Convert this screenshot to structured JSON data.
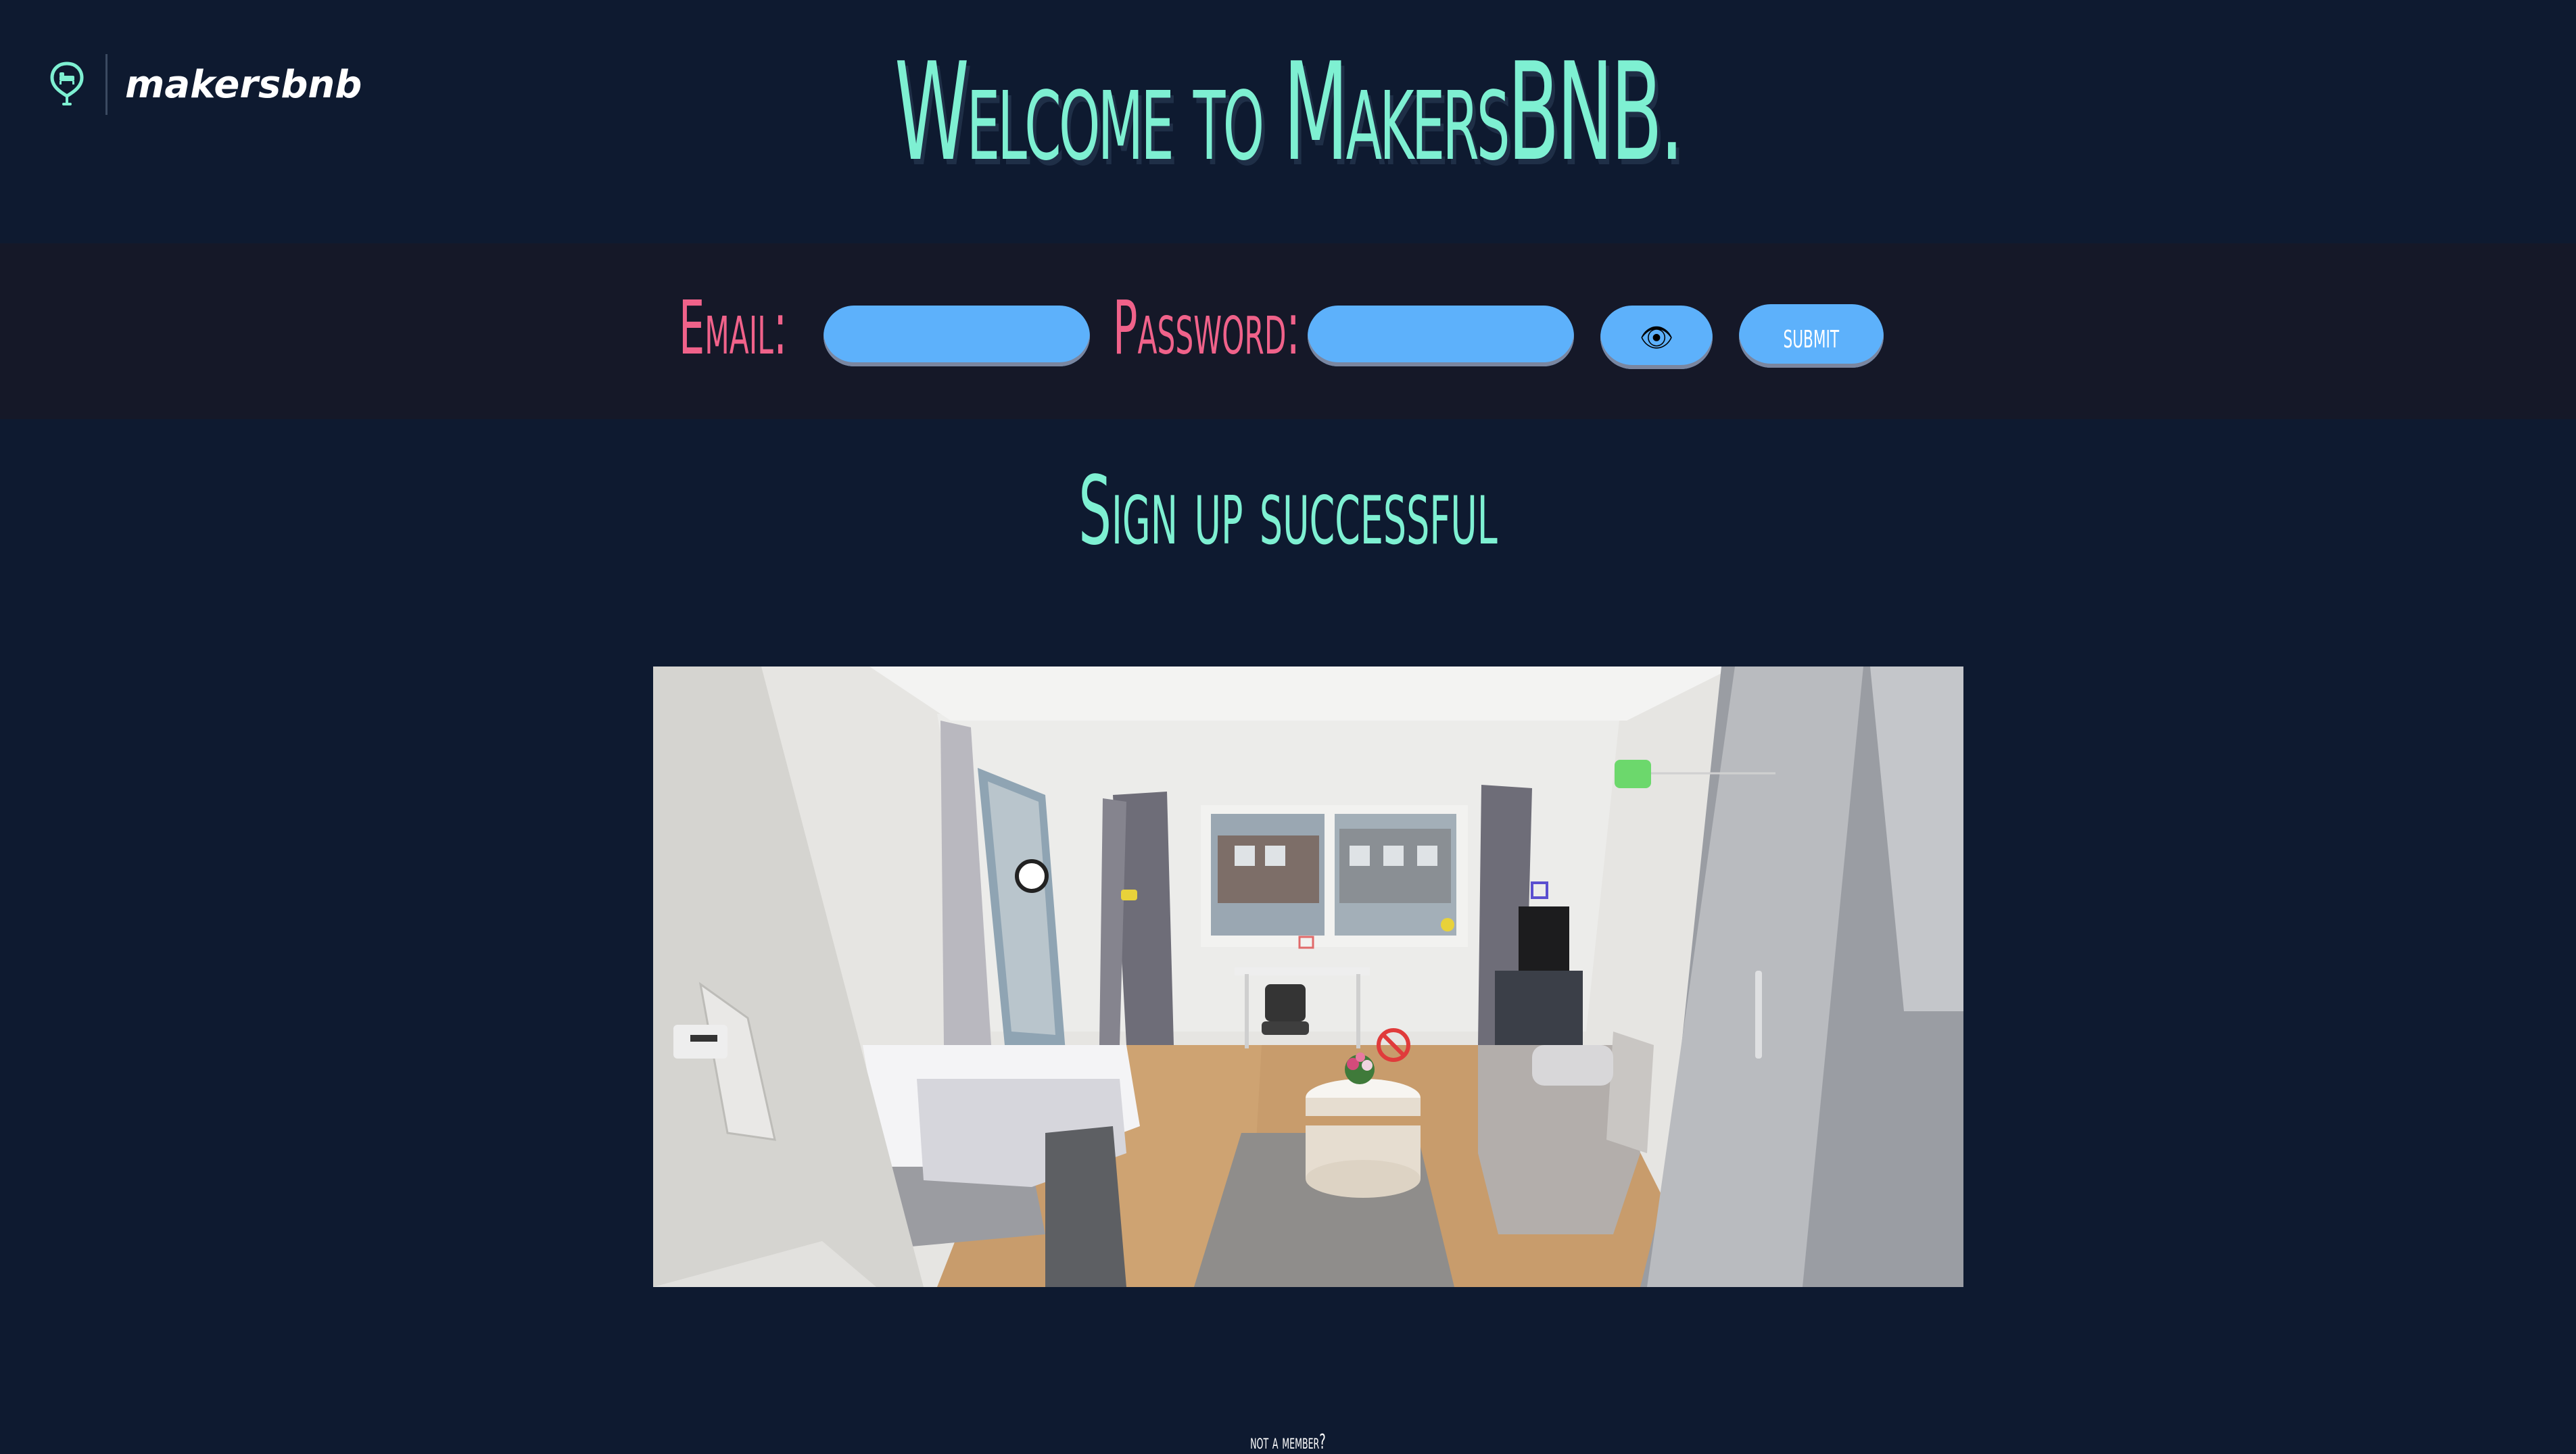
{
  "header": {
    "logo_text": "makersbnb",
    "logo_icon": "map-pin-bed-icon",
    "title": "Welcome to MakersBNB."
  },
  "login": {
    "email_label": "Email:",
    "email_value": "",
    "password_label": "Password:",
    "password_value": "",
    "show_password_icon": "eye-icon",
    "show_password_glyph": "👁",
    "submit_label": "submit"
  },
  "main": {
    "status_message": "Sign up successful",
    "photo_subject": "apartment-room-photo"
  },
  "footer": {
    "signup_prompt": "not a member?"
  },
  "colors": {
    "background": "#0e1a30",
    "login_band": "#151828",
    "accent_teal": "#7ef0d2",
    "label_pink": "#f0628a",
    "button_blue": "#5db1fb"
  }
}
